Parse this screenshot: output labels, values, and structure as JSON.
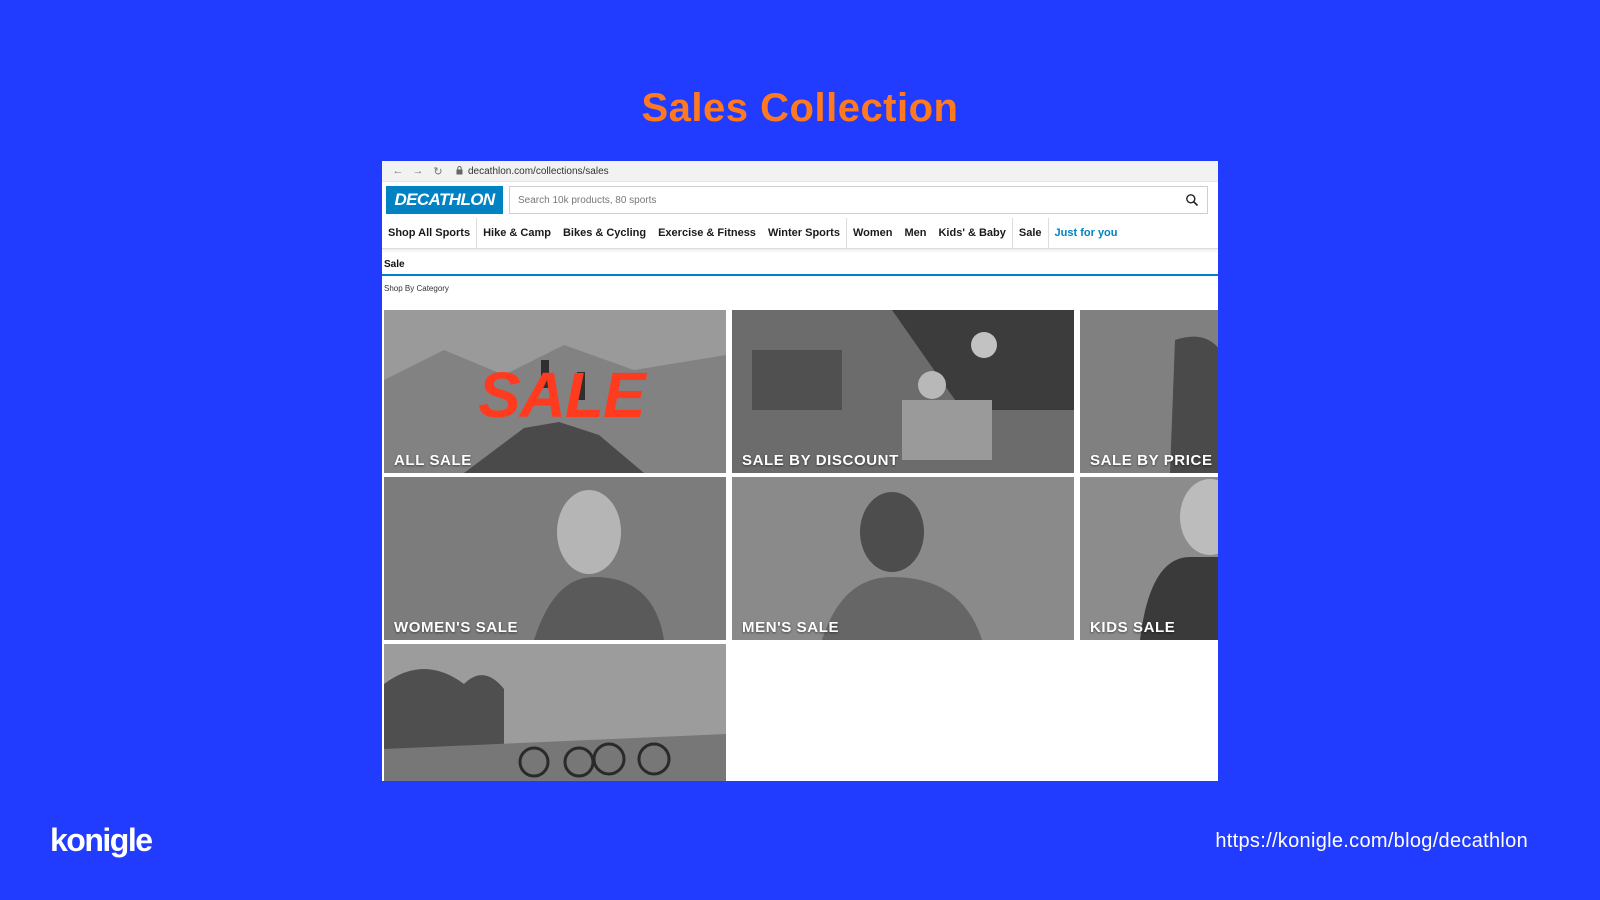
{
  "slide": {
    "title": "Sales Collection",
    "brand": "konigle",
    "url": "https://konigle.com/blog/decathlon"
  },
  "browser": {
    "address": "decathlon.com/collections/sales",
    "back_icon": "arrow-left-icon",
    "forward_icon": "arrow-right-icon",
    "reload_icon": "reload-icon",
    "lock_icon": "lock-icon"
  },
  "site": {
    "logo": "DECATHLON",
    "logo_color": "#0082c3",
    "search_placeholder": "Search 10k products, 80 sports",
    "search_icon": "search-icon",
    "nav": [
      "Shop All Sports",
      "Hike & Camp",
      "Bikes & Cycling",
      "Exercise & Fitness",
      "Winter Sports",
      "Women",
      "Men",
      "Kids' & Baby",
      "Sale",
      "Just for you"
    ],
    "section_title": "Sale",
    "sub_title": "Shop By Category",
    "sale_overlay": "SALE",
    "tiles": [
      "ALL SALE",
      "SALE BY DISCOUNT",
      "SALE BY PRICE",
      "WOMEN'S SALE",
      "MEN'S SALE",
      "KIDS SALE",
      ""
    ]
  },
  "colors": {
    "background": "#223cff",
    "title": "#ff7a1f",
    "accent": "#0082c3",
    "sale_red": "#ff3b1f"
  }
}
